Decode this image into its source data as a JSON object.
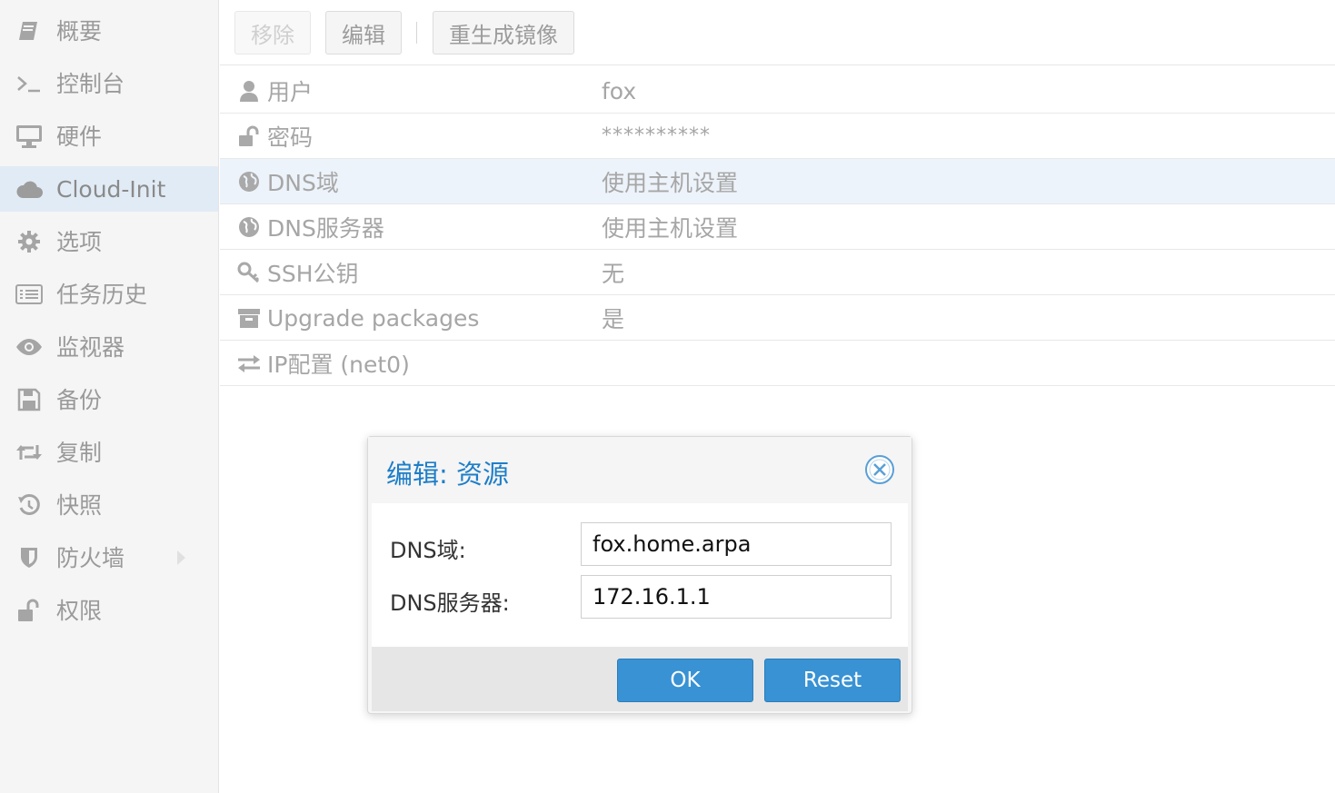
{
  "sidebar": {
    "items": [
      {
        "label": "概要",
        "icon": "book-icon"
      },
      {
        "label": "控制台",
        "icon": "terminal-icon"
      },
      {
        "label": "硬件",
        "icon": "desktop-icon"
      },
      {
        "label": "Cloud-Init",
        "icon": "cloud-icon",
        "active": true
      },
      {
        "label": "选项",
        "icon": "gear-icon"
      },
      {
        "label": "任务历史",
        "icon": "list-icon"
      },
      {
        "label": "监视器",
        "icon": "eye-icon"
      },
      {
        "label": "备份",
        "icon": "floppy-icon"
      },
      {
        "label": "复制",
        "icon": "retweet-icon"
      },
      {
        "label": "快照",
        "icon": "history-icon"
      },
      {
        "label": "防火墙",
        "icon": "shield-icon"
      },
      {
        "label": "权限",
        "icon": "unlock-icon"
      }
    ]
  },
  "toolbar": {
    "remove_label": "移除",
    "edit_label": "编辑",
    "regenerate_label": "重生成镜像"
  },
  "grid": {
    "rows": [
      {
        "key": "用户",
        "value": "fox",
        "icon": "user-icon"
      },
      {
        "key": "密码",
        "value": "**********",
        "icon": "unlock-icon"
      },
      {
        "key": "DNS域",
        "value": "使用主机设置",
        "icon": "globe-icon"
      },
      {
        "key": "DNS服务器",
        "value": "使用主机设置",
        "icon": "globe-icon"
      },
      {
        "key": "SSH公钥",
        "value": "无",
        "icon": "key-icon"
      },
      {
        "key": "Upgrade packages",
        "value": "是",
        "icon": "archive-icon"
      },
      {
        "key": "IP配置 (net0)",
        "value": "",
        "icon": "exchange-icon"
      }
    ]
  },
  "dialog": {
    "title": "编辑: 资源",
    "fields": [
      {
        "label": "DNS域:",
        "value": "fox.home.arpa"
      },
      {
        "label": "DNS服务器:",
        "value": "172.16.1.1"
      }
    ],
    "ok_label": "OK",
    "reset_label": "Reset"
  },
  "colors": {
    "accent": "#3892d4",
    "title_blue": "#1e7ec8",
    "selected_row": "#edf3fa"
  }
}
